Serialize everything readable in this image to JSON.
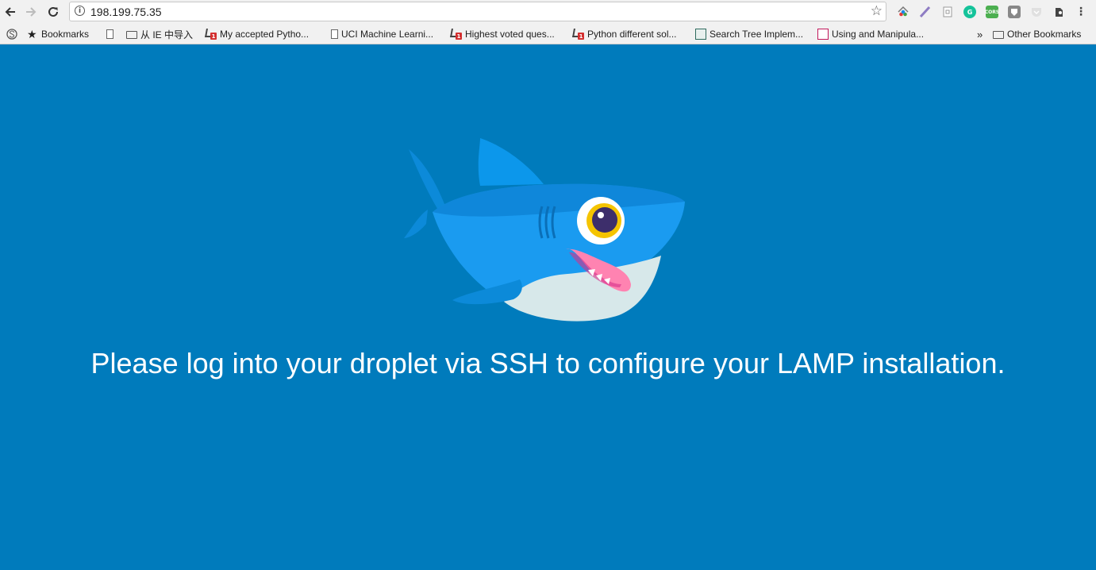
{
  "browser": {
    "url": "198.199.75.35",
    "bookmarks_bar": {
      "apps_label": "",
      "items": [
        {
          "label": "Bookmarks",
          "icon": "star-icon"
        },
        {
          "label": "",
          "icon": "page-icon"
        },
        {
          "label": "从 IE 中导入",
          "icon": "folder-icon"
        },
        {
          "label": "My accepted Pytho...",
          "icon": "stackoverflow-icon"
        },
        {
          "label": "UCI Machine Learni...",
          "icon": "page-icon"
        },
        {
          "label": "Highest voted ques...",
          "icon": "stackoverflow-icon"
        },
        {
          "label": "Python different sol...",
          "icon": "stackoverflow-icon"
        },
        {
          "label": "Search Tree Implem...",
          "icon": "document-icon"
        },
        {
          "label": "Using and Manipula...",
          "icon": "cs-icon"
        }
      ],
      "overflow": "»",
      "other_label": "Other Bookmarks"
    },
    "extensions": [
      "home-color-icon",
      "pen-icon",
      "document-icon",
      "grammarly-icon",
      "cors-icon",
      "shield-icon",
      "pocket-icon",
      "evernote-icon",
      "menu-icon"
    ]
  },
  "page": {
    "message": "Please log into your droplet via SSH to configure your LAMP installation.",
    "colors": {
      "background": "#007bbc",
      "text": "#ffffff"
    },
    "illustration": "shark-mascot"
  }
}
